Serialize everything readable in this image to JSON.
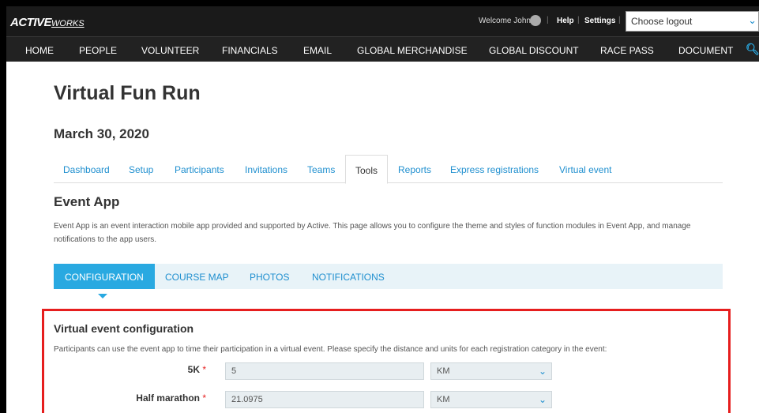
{
  "topbar": {
    "logo_main": "ACTIVE",
    "logo_sub": "WORKS",
    "welcome": "Welcome John",
    "help": "Help",
    "settings": "Settings",
    "logout_placeholder": "Choose logout"
  },
  "nav": {
    "items": [
      "HOME",
      "PEOPLE",
      "VOLUNTEER",
      "FINANCIALS",
      "EMAIL",
      "GLOBAL MERCHANDISE",
      "GLOBAL DISCOUNT",
      "RACE PASS",
      "DOCUMENT"
    ]
  },
  "event": {
    "title": "Virtual Fun Run",
    "date": "March 30, 2020"
  },
  "tabs": [
    "Dashboard",
    "Setup",
    "Participants",
    "Invitations",
    "Teams",
    "Tools",
    "Reports",
    "Express registrations",
    "Virtual event"
  ],
  "event_app": {
    "title": "Event App",
    "desc": "Event App is an event interaction mobile app provided and supported by Active. This page allows you to configure the theme and styles of function modules in Event App, and manage notifications to the app users."
  },
  "subtabs": [
    "CONFIGURATION",
    "COURSE MAP",
    "PHOTOS",
    "NOTIFICATIONS"
  ],
  "config": {
    "title": "Virtual event configuration",
    "desc": "Participants can use the event app to time their participation in a virtual event. Please specify the distance and units for each registration category in the event:",
    "required_mark": "*",
    "rows": [
      {
        "label": "5K",
        "distance": "5",
        "unit": "KM"
      },
      {
        "label": "Half marathon",
        "distance": "21.0975",
        "unit": "KM"
      }
    ]
  },
  "colors": {
    "accent": "#29a9e1",
    "link": "#1f8fcf",
    "highlight_box": "#e61e1e",
    "topbar": "#1a1a1a"
  }
}
